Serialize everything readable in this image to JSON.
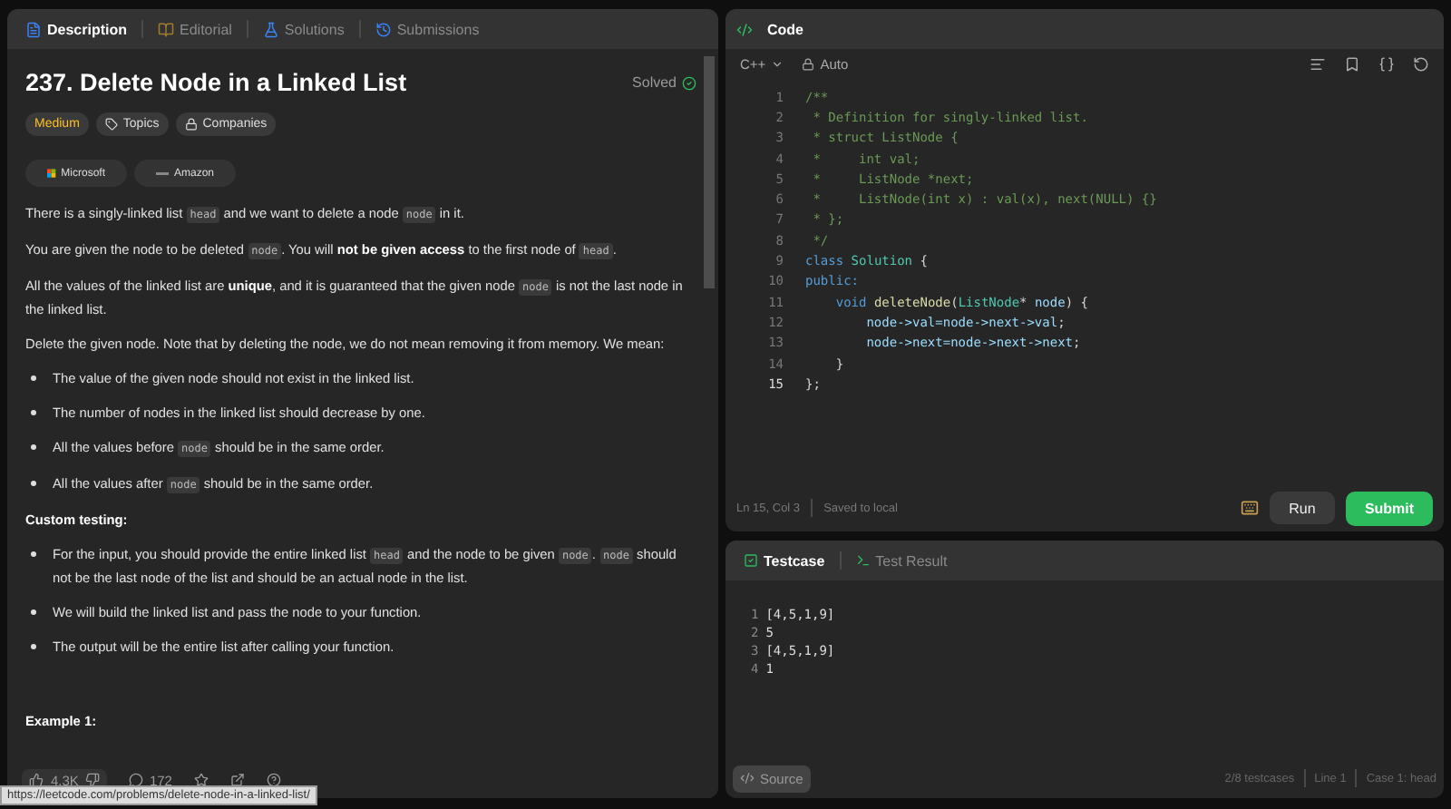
{
  "left_panel": {
    "tabs": [
      {
        "label": "Description",
        "selected": true
      },
      {
        "label": "Editorial",
        "selected": false
      },
      {
        "label": "Solutions",
        "selected": false
      },
      {
        "label": "Submissions",
        "selected": false
      }
    ],
    "title": "237. Delete Node in a Linked List",
    "status": "Solved",
    "tags": [
      {
        "label": "Medium",
        "kind": "difficulty"
      },
      {
        "label": "Topics",
        "kind": "tag"
      },
      {
        "label": "Companies",
        "kind": "lock"
      }
    ],
    "companies": [
      {
        "label": "Microsoft",
        "kind": "grid"
      },
      {
        "label": "Amazon",
        "kind": "dash"
      }
    ],
    "content": [
      {
        "kind": "p",
        "parts": [
          {
            "kind": "text",
            "s": "There is a singly-linked list "
          },
          {
            "kind": "code",
            "s": "head"
          },
          {
            "kind": "text",
            "s": " and we want to delete a node "
          },
          {
            "kind": "code",
            "s": "node"
          },
          {
            "kind": "text",
            "s": " in it."
          }
        ]
      },
      {
        "kind": "p",
        "parts": [
          {
            "kind": "text",
            "s": "You are given the node to be deleted "
          },
          {
            "kind": "code",
            "s": "node"
          },
          {
            "kind": "text",
            "s": ". You will "
          },
          {
            "kind": "bold",
            "s": "not be given access"
          },
          {
            "kind": "text",
            "s": " to the first node of "
          },
          {
            "kind": "code",
            "s": "head"
          },
          {
            "kind": "text",
            "s": "."
          }
        ]
      },
      {
        "kind": "p",
        "parts": [
          {
            "kind": "text",
            "s": "All the values of the linked list are "
          },
          {
            "kind": "bold",
            "s": "unique"
          },
          {
            "kind": "text",
            "s": ", and it is guaranteed that the given node "
          },
          {
            "kind": "code",
            "s": "node"
          },
          {
            "kind": "text",
            "s": " is not the last node in the linked list."
          }
        ]
      },
      {
        "kind": "p",
        "parts": [
          {
            "kind": "text",
            "s": "Delete the given node. Note that by deleting the node, we do not mean removing it from memory. We mean:"
          }
        ]
      },
      {
        "kind": "li",
        "parts": [
          {
            "kind": "text",
            "s": "The value of the given node should not exist in the linked list."
          }
        ]
      },
      {
        "kind": "li",
        "parts": [
          {
            "kind": "text",
            "s": "The number of nodes in the linked list should decrease by one."
          }
        ]
      },
      {
        "kind": "li",
        "parts": [
          {
            "kind": "text",
            "s": "All the values before "
          },
          {
            "kind": "code",
            "s": "node"
          },
          {
            "kind": "text",
            "s": " should be in the same order."
          }
        ]
      },
      {
        "kind": "li",
        "parts": [
          {
            "kind": "text",
            "s": "All the values after "
          },
          {
            "kind": "code",
            "s": "node"
          },
          {
            "kind": "text",
            "s": " should be in the same order."
          }
        ]
      },
      {
        "kind": "heading",
        "parts": [
          {
            "kind": "text",
            "s": "Custom testing:"
          }
        ]
      },
      {
        "kind": "li",
        "parts": [
          {
            "kind": "text",
            "s": "For the input, you should provide the entire linked list "
          },
          {
            "kind": "code",
            "s": "head"
          },
          {
            "kind": "text",
            "s": " and the node to be given "
          },
          {
            "kind": "code",
            "s": "node"
          },
          {
            "kind": "text",
            "s": ". "
          },
          {
            "kind": "code",
            "s": "node"
          },
          {
            "kind": "text",
            "s": " should not be the last node of the list and should be an actual node in the list."
          }
        ]
      },
      {
        "kind": "li",
        "parts": [
          {
            "kind": "text",
            "s": "We will build the linked list and pass the node to your function."
          }
        ]
      },
      {
        "kind": "li",
        "parts": [
          {
            "kind": "text",
            "s": "The output will be the entire list after calling your function."
          }
        ]
      },
      {
        "kind": "example",
        "parts": [
          {
            "kind": "text",
            "s": "Example 1:"
          }
        ]
      }
    ],
    "footer": {
      "likes": "4.3K",
      "comments": "172"
    },
    "status_url": "https://leetcode.com/problems/delete-node-in-a-linked-list/"
  },
  "code_panel": {
    "title": "Code",
    "language": "C++",
    "mode": "Auto",
    "lines": [
      {
        "n": "1",
        "tokens": [
          {
            "kind": "comment",
            "s": "/**"
          }
        ]
      },
      {
        "n": "2",
        "tokens": [
          {
            "kind": "comment",
            "s": " * Definition for singly-linked list."
          }
        ]
      },
      {
        "n": "3",
        "tokens": [
          {
            "kind": "comment",
            "s": " * struct ListNode {"
          }
        ]
      },
      {
        "n": "4",
        "tokens": [
          {
            "kind": "comment",
            "s": " *     int val;"
          }
        ]
      },
      {
        "n": "5",
        "tokens": [
          {
            "kind": "comment",
            "s": " *     ListNode *next;"
          }
        ]
      },
      {
        "n": "6",
        "tokens": [
          {
            "kind": "comment",
            "s": " *     ListNode(int x) : val(x), next(NULL) {}"
          }
        ]
      },
      {
        "n": "7",
        "tokens": [
          {
            "kind": "comment",
            "s": " * };"
          }
        ]
      },
      {
        "n": "8",
        "tokens": [
          {
            "kind": "comment",
            "s": " */"
          }
        ]
      },
      {
        "n": "9",
        "tokens": [
          {
            "kind": "keyword",
            "s": "class "
          },
          {
            "kind": "type",
            "s": "Solution"
          },
          {
            "kind": "plain",
            "s": " {"
          }
        ]
      },
      {
        "n": "10",
        "tokens": [
          {
            "kind": "keyword",
            "s": "public:"
          }
        ]
      },
      {
        "n": "11",
        "tokens": [
          {
            "kind": "keyword",
            "s": "    void "
          },
          {
            "kind": "func",
            "s": "deleteNode"
          },
          {
            "kind": "plain",
            "s": "("
          },
          {
            "kind": "type",
            "s": "ListNode"
          },
          {
            "kind": "plain",
            "s": "* "
          },
          {
            "kind": "var",
            "s": "node"
          },
          {
            "kind": "plain",
            "s": ") {"
          }
        ]
      },
      {
        "n": "12",
        "tokens": [
          {
            "kind": "var",
            "s": "        node->val=node->next->val"
          },
          {
            "kind": "plain",
            "s": ";"
          }
        ]
      },
      {
        "n": "13",
        "tokens": [
          {
            "kind": "var",
            "s": "        node->next=node->next->next"
          },
          {
            "kind": "plain",
            "s": ";"
          }
        ]
      },
      {
        "n": "14",
        "tokens": [
          {
            "kind": "plain",
            "s": "    }"
          }
        ]
      },
      {
        "n": "15",
        "tokens": [
          {
            "kind": "plain",
            "s": "};"
          }
        ]
      }
    ],
    "cursor": "Ln 15, Col 3",
    "saved": "Saved to local",
    "run": "Run",
    "submit": "Submit"
  },
  "test_panel": {
    "tabs": [
      {
        "label": "Testcase",
        "selected": true
      },
      {
        "label": "Test Result",
        "selected": false
      }
    ],
    "lines": [
      {
        "n": "1",
        "s": "[4,5,1,9]"
      },
      {
        "n": "2",
        "s": "5"
      },
      {
        "n": "3",
        "s": "[4,5,1,9]"
      },
      {
        "n": "4",
        "s": "1"
      }
    ],
    "source": "Source",
    "info": [
      "2/8 testcases",
      "Line 1",
      "Case 1: head"
    ]
  }
}
